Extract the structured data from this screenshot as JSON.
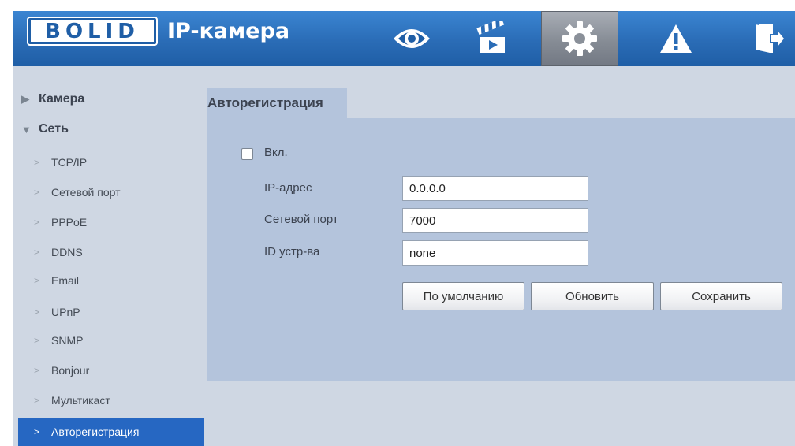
{
  "header": {
    "logo_text": "BOLID",
    "app_title": "IP-камера",
    "nav": [
      {
        "icon": "eye-icon",
        "active": false
      },
      {
        "icon": "clapperboard-icon",
        "active": false
      },
      {
        "icon": "gear-icon",
        "active": true
      },
      {
        "icon": "warning-icon",
        "active": false
      },
      {
        "icon": "exit-icon",
        "active": false
      }
    ]
  },
  "sidebar": {
    "categories": [
      {
        "label": "Камера",
        "expanded": false
      },
      {
        "label": "Сеть",
        "expanded": true
      }
    ],
    "items": [
      {
        "label": "TCP/IP"
      },
      {
        "label": "Сетевой порт"
      },
      {
        "label": "PPPoE"
      },
      {
        "label": "DDNS"
      },
      {
        "label": "Email"
      },
      {
        "label": "UPnP"
      },
      {
        "label": "SNMP"
      },
      {
        "label": "Bonjour"
      },
      {
        "label": "Мультикаст"
      },
      {
        "label": "Авторегистрация",
        "selected": true
      }
    ],
    "arrow_glyph": ">",
    "collapsed_glyph": "▶",
    "expanded_glyph": "▼"
  },
  "main": {
    "tab_label": "Авторегистрация",
    "enable": {
      "label": "Вкл.",
      "checked": false
    },
    "fields": [
      {
        "label": "IP-адрес",
        "value": "0.0.0.0"
      },
      {
        "label": "Сетевой порт",
        "value": "7000"
      },
      {
        "label": "ID устр-ва",
        "value": "none"
      }
    ],
    "buttons": {
      "default_label": "По умолчанию",
      "refresh_label": "Обновить",
      "save_label": "Сохранить"
    }
  },
  "colors": {
    "header_blue": "#2a6cb6",
    "sidebar_bg": "#cfd7e3",
    "panel_bg": "#b4c4dc",
    "selected_blue": "#2667c2"
  }
}
